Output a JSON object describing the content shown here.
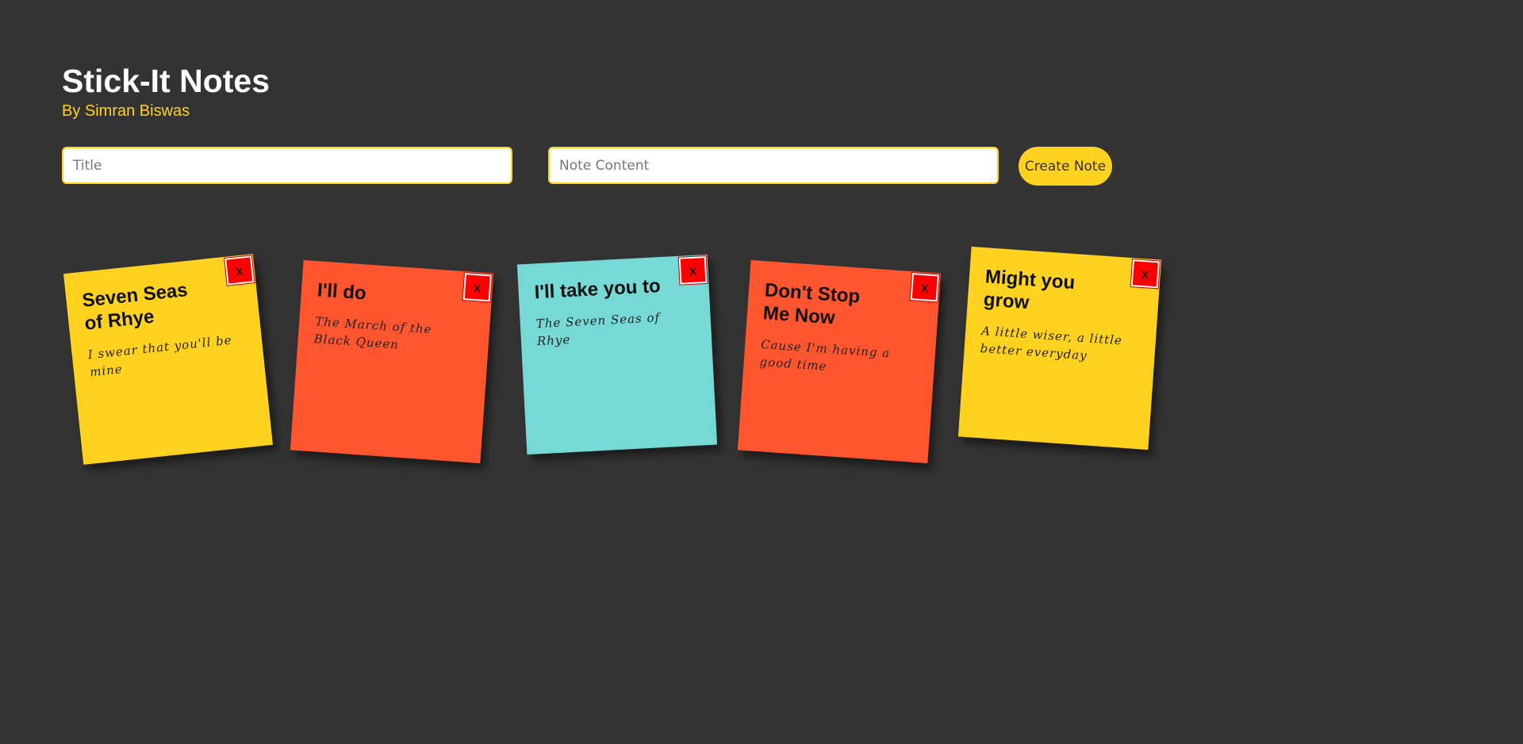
{
  "header": {
    "title": "Stick-It Notes",
    "subtitle": "By Simran Biswas"
  },
  "form": {
    "title_placeholder": "Title",
    "title_value": "",
    "content_placeholder": "Note Content",
    "content_value": "",
    "create_label": "Create Note"
  },
  "colors": {
    "background": "#333333",
    "accent": "#ffd21f",
    "note_yellow": "#ffd21f",
    "note_orange": "#ff5630",
    "note_teal": "#76d9d5",
    "delete_red": "#ff0000"
  },
  "notes": [
    {
      "title": "Seven Seas of Rhye",
      "body": "I swear that you'll be mine",
      "delete_label": "x",
      "color": "yellow"
    },
    {
      "title": "I'll do",
      "body": "The March of the Black Queen",
      "delete_label": "x",
      "color": "orange"
    },
    {
      "title": "I'll take you to",
      "body": "The Seven Seas of Rhye",
      "delete_label": "x",
      "color": "teal"
    },
    {
      "title": "Don't Stop Me Now",
      "body": "Cause I'm having a good time",
      "delete_label": "x",
      "color": "orange"
    },
    {
      "title": "Might you grow",
      "body": "A little wiser, a little better everyday",
      "delete_label": "x",
      "color": "yellow"
    }
  ]
}
